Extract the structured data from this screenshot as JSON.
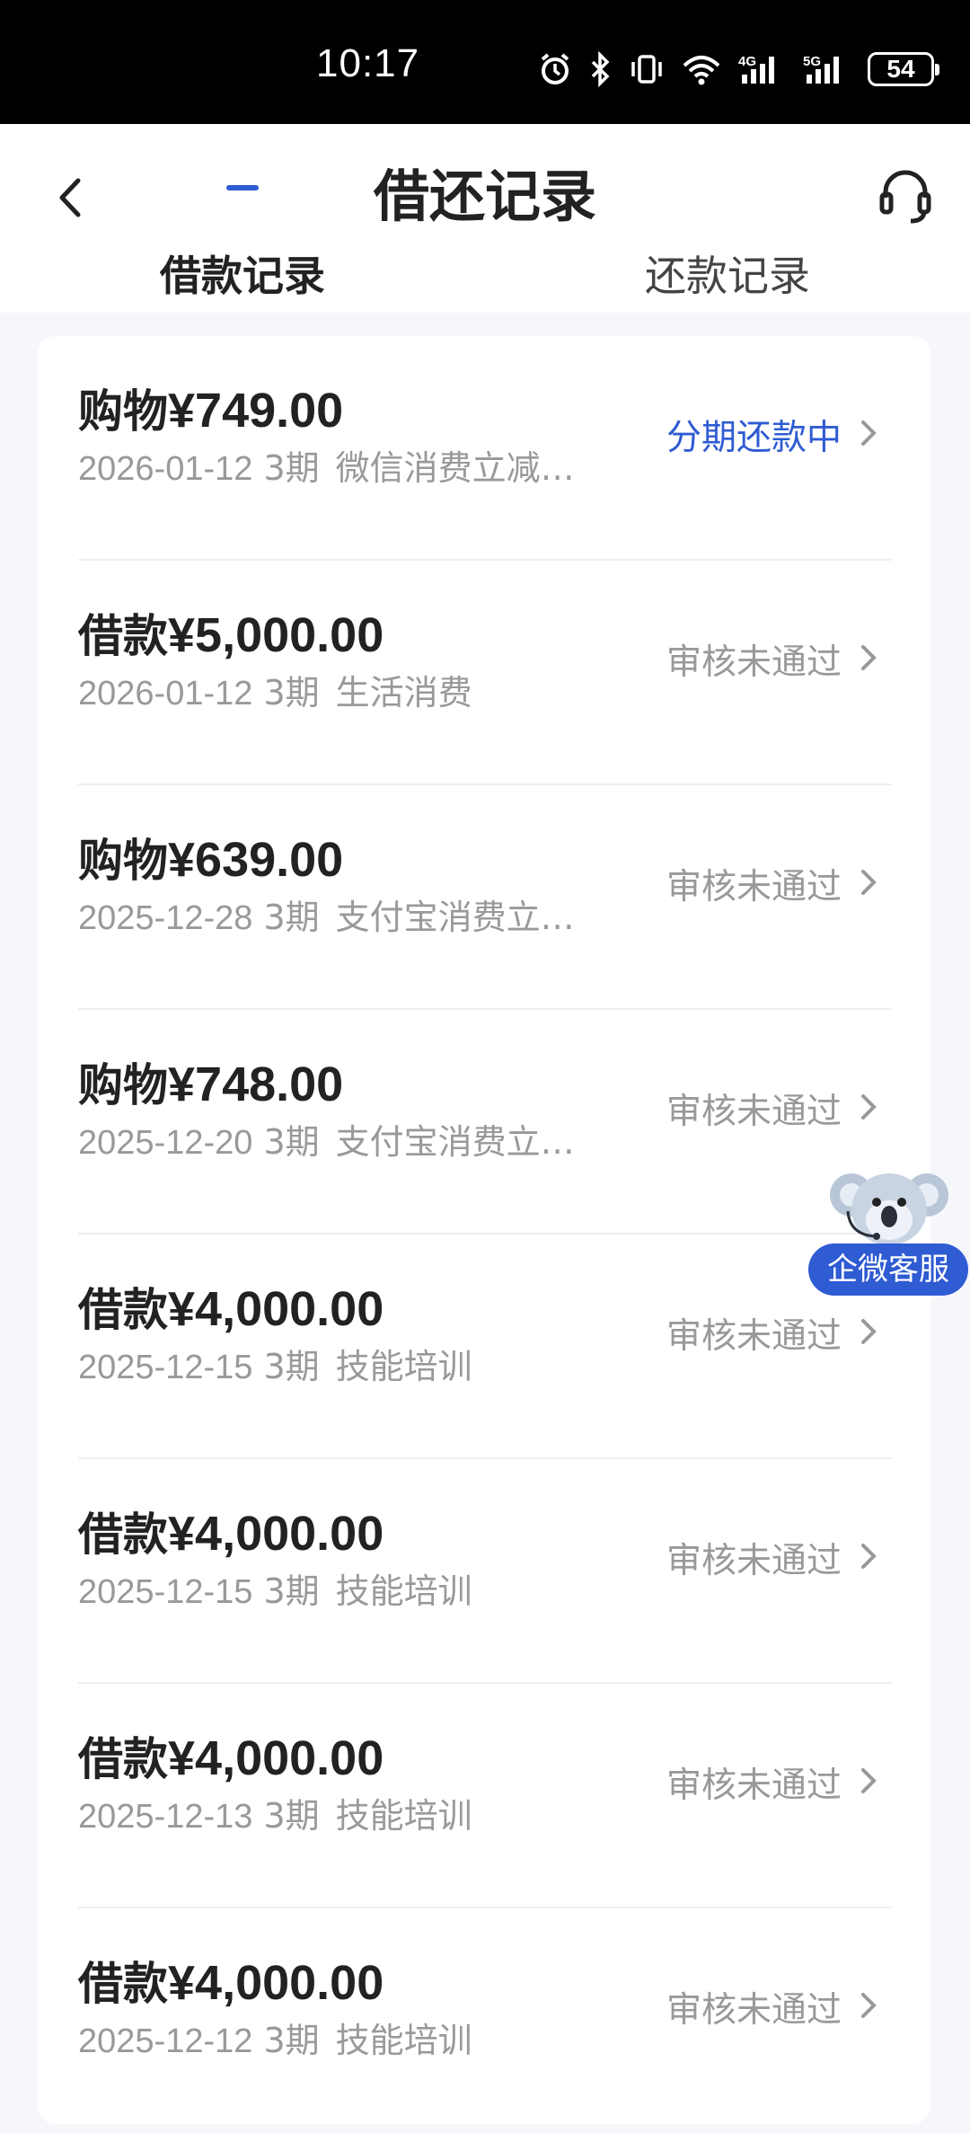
{
  "status_bar": {
    "time": "10:17",
    "network_1": "4G",
    "network_2": "5G",
    "battery": "54"
  },
  "header": {
    "title": "借还记录",
    "back_icon": "chevron-left-icon",
    "support_icon": "headset-icon"
  },
  "tabs": [
    {
      "label": "借款记录",
      "active": true
    },
    {
      "label": "还款记录",
      "active": false
    }
  ],
  "records": [
    {
      "type": "购物",
      "amount": "¥749.00",
      "date": "2026-01-12",
      "term": "3期",
      "desc": "微信消费立减…",
      "status": "分期还款中"
    },
    {
      "type": "借款",
      "amount": "¥5,000.00",
      "date": "2026-01-12",
      "term": "3期",
      "desc": "生活消费",
      "status": "审核未通过"
    },
    {
      "type": "购物",
      "amount": "¥639.00",
      "date": "2025-12-28",
      "term": "3期",
      "desc": "支付宝消费立…",
      "status": "审核未通过"
    },
    {
      "type": "购物",
      "amount": "¥748.00",
      "date": "2025-12-20",
      "term": "3期",
      "desc": "支付宝消费立…",
      "status": "审核未通过"
    },
    {
      "type": "借款",
      "amount": "¥4,000.00",
      "date": "2025-12-15",
      "term": "3期",
      "desc": "技能培训",
      "status": "审核未通过"
    },
    {
      "type": "借款",
      "amount": "¥4,000.00",
      "date": "2025-12-15",
      "term": "3期",
      "desc": "技能培训",
      "status": "审核未通过"
    },
    {
      "type": "借款",
      "amount": "¥4,000.00",
      "date": "2025-12-13",
      "term": "3期",
      "desc": "技能培训",
      "status": "审核未通过"
    },
    {
      "type": "借款",
      "amount": "¥4,000.00",
      "date": "2025-12-12",
      "term": "3期",
      "desc": "技能培训",
      "status": "审核未通过"
    }
  ],
  "float_service": {
    "label": "企微客服",
    "icon": "koala-mascot-icon"
  },
  "colors": {
    "accent": "#2f5bd3",
    "muted": "#999999",
    "background": "#f6f7fb"
  }
}
